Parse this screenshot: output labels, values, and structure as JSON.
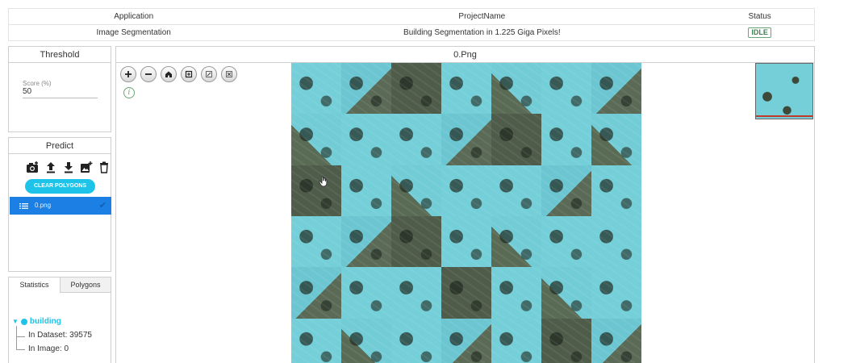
{
  "header": {
    "col_application": "Application",
    "col_project": "ProjectName",
    "col_status": "Status",
    "application": "Image Segmentation",
    "project": "Building Segmentation in 1.225 Giga Pixels!",
    "status": "IDLE"
  },
  "threshold": {
    "title": "Threshold",
    "score_label": "Score (%)",
    "score_value": "50"
  },
  "predict": {
    "title": "Predict",
    "tools": [
      "camera-add-icon",
      "upload-icon",
      "download-icon",
      "add-image-icon",
      "trash-icon"
    ],
    "clear_label": "CLEAR POLYGONS",
    "files": [
      {
        "name": "0.png",
        "checked": true
      }
    ]
  },
  "stats": {
    "tab_statistics": "Statistics",
    "tab_polygons": "Polygons",
    "class_name": "building",
    "in_dataset": "In Dataset: 39575",
    "in_image": "In Image: 0"
  },
  "viewer": {
    "title": "0.Png",
    "controls": [
      "zoom-in-icon",
      "zoom-out-icon",
      "home-icon",
      "fullpage-icon",
      "rotate-icon",
      "flip-icon"
    ]
  },
  "colors": {
    "accent": "#1ec3ea",
    "selected": "#1c7fe3",
    "status": "#3f7f50",
    "mask": "#74cfd9"
  }
}
